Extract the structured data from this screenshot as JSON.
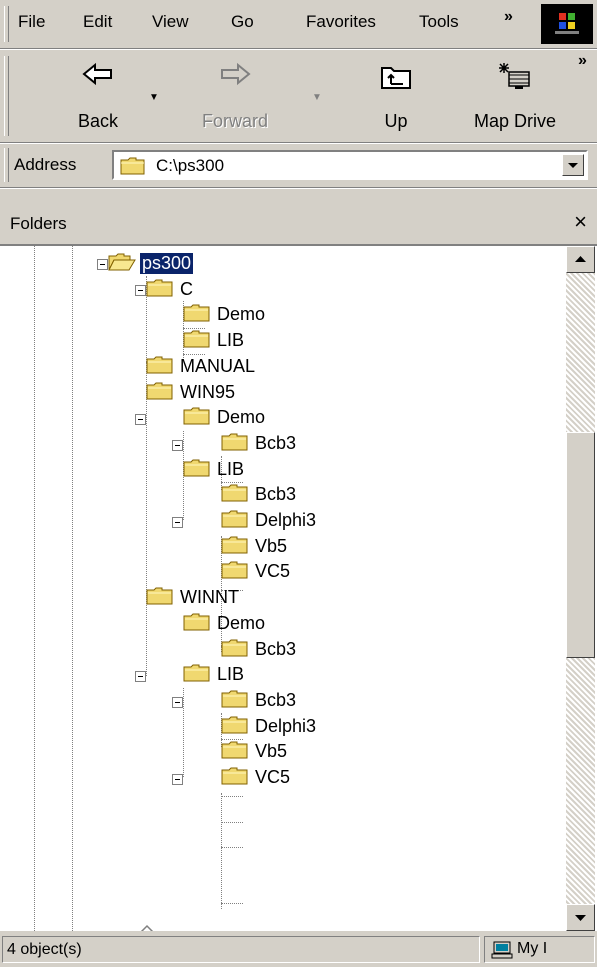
{
  "menu": {
    "items": [
      {
        "label": "File"
      },
      {
        "label": "Edit"
      },
      {
        "label": "View"
      },
      {
        "label": "Go"
      },
      {
        "label": "Favorites"
      },
      {
        "label": "Tools"
      }
    ],
    "overflow": "»"
  },
  "toolbar": {
    "back": "Back",
    "forward": "Forward",
    "up": "Up",
    "map_drive": "Map Drive",
    "overflow": "»"
  },
  "address": {
    "label": "Address",
    "value": "C:\\ps300"
  },
  "folders": {
    "title": "Folders",
    "close": "×",
    "tree": [
      {
        "label": "ps300",
        "selected": true
      },
      {
        "label": "C"
      },
      {
        "label": "Demo"
      },
      {
        "label": "LIB"
      },
      {
        "label": "MANUAL"
      },
      {
        "label": "WIN95"
      },
      {
        "label": "Demo"
      },
      {
        "label": "Bcb3"
      },
      {
        "label": "LIB"
      },
      {
        "label": "Bcb3"
      },
      {
        "label": "Delphi3"
      },
      {
        "label": "Vb5"
      },
      {
        "label": "VC5"
      },
      {
        "label": "WINNT"
      },
      {
        "label": "Demo"
      },
      {
        "label": "Bcb3"
      },
      {
        "label": "LIB"
      },
      {
        "label": "Bcb3"
      },
      {
        "label": "Delphi3"
      },
      {
        "label": "Vb5"
      },
      {
        "label": "VC5"
      }
    ]
  },
  "status": {
    "objects": "4 object(s)",
    "zone": "My I"
  },
  "colors": {
    "chrome": "#d4d0c8",
    "selection": "#0a246a",
    "folder": "#f0d870"
  }
}
